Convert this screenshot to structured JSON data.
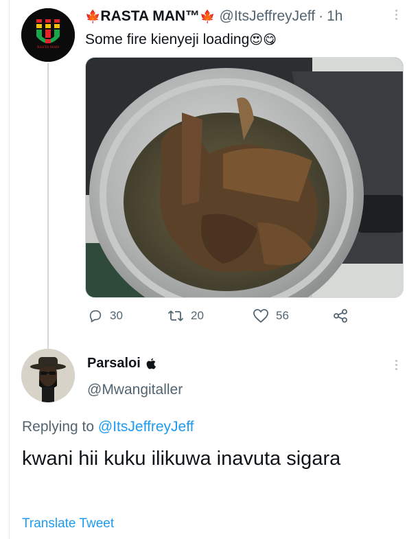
{
  "tweet": {
    "name": "RASTA MAN™",
    "name_emoji_left": "🍁",
    "name_emoji_right": "🍁",
    "handle": "@ItsJeffreyJeff",
    "separator": "·",
    "time": "1h",
    "text": "Some fire kienyeji loading",
    "text_emojis": "😍😋",
    "avatar_caption": "RASTA MAN",
    "avatar_color_top": "#e0262b",
    "avatar_color_mid": "#f2c200",
    "avatar_color_bot": "#1aa64a"
  },
  "actions": {
    "replies": "30",
    "retweets": "20",
    "likes": "56"
  },
  "reply": {
    "name": "Parsaloi",
    "name_icon": "apple-icon",
    "handle": "@Mwangitaller",
    "replying_prefix": "Replying to",
    "replying_to": "@ItsJeffreyJeff",
    "text": "kwani hii kuku ilikuwa inavuta sigara",
    "translate": "Translate Tweet"
  },
  "colors": {
    "link": "#1d9bf0",
    "muted": "#536471",
    "text": "#0f1419",
    "thread_line": "#cfd9de"
  }
}
